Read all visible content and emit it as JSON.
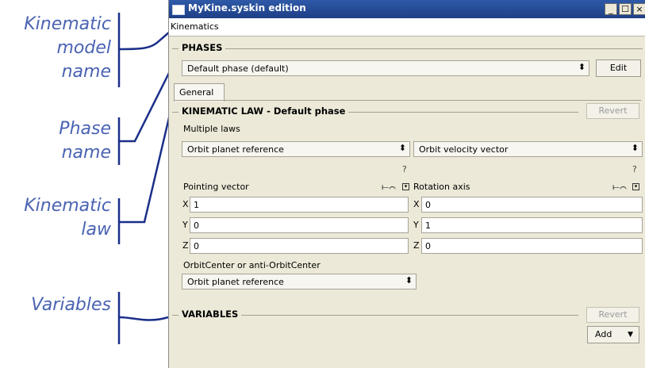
{
  "annotations": {
    "kinematic_model_name": [
      "Kinematic",
      "model",
      "name"
    ],
    "phase_name": [
      "Phase",
      "name"
    ],
    "kinematic_law": [
      "Kinematic",
      "law"
    ],
    "variables": "Variables"
  },
  "window": {
    "title": "MyKine.syskin edition",
    "minimize_icon": "_",
    "maximize_icon": "☐",
    "close_icon": "×"
  },
  "menubar": {
    "model_name": "Kinematics"
  },
  "phases": {
    "group_label": "PHASES",
    "selected_phase": "Default phase (default)",
    "edit_label": "Edit"
  },
  "tabs": [
    {
      "label": "General"
    }
  ],
  "kinematic_law": {
    "group_label": "KINEMATIC LAW - Default phase",
    "revert_label": "Revert",
    "multiple_laws_label": "Multiple laws",
    "left_select": "Orbit planet reference",
    "right_select": "Orbit velocity vector",
    "help_left": "?",
    "help_right": "?",
    "pointing_vector_label": "Pointing vector",
    "rotation_axis_label": "Rotation axis",
    "pointing": {
      "x": "1",
      "y": "0",
      "z": "0"
    },
    "rotation": {
      "x": "0",
      "y": "1",
      "z": "0"
    },
    "orbitcenter_label": "OrbitCenter or anti-OrbitCenter",
    "orbitcenter_select": "Orbit planet reference"
  },
  "variables": {
    "group_label": "VARIABLES",
    "revert_label": "Revert",
    "add_label": "Add"
  },
  "axis_labels": {
    "x": "X",
    "y": "Y",
    "z": "Z"
  },
  "colors": {
    "annotation": "#4a63b3",
    "window_bg": "#ece9d8",
    "titlebar": "#1e3f86"
  }
}
